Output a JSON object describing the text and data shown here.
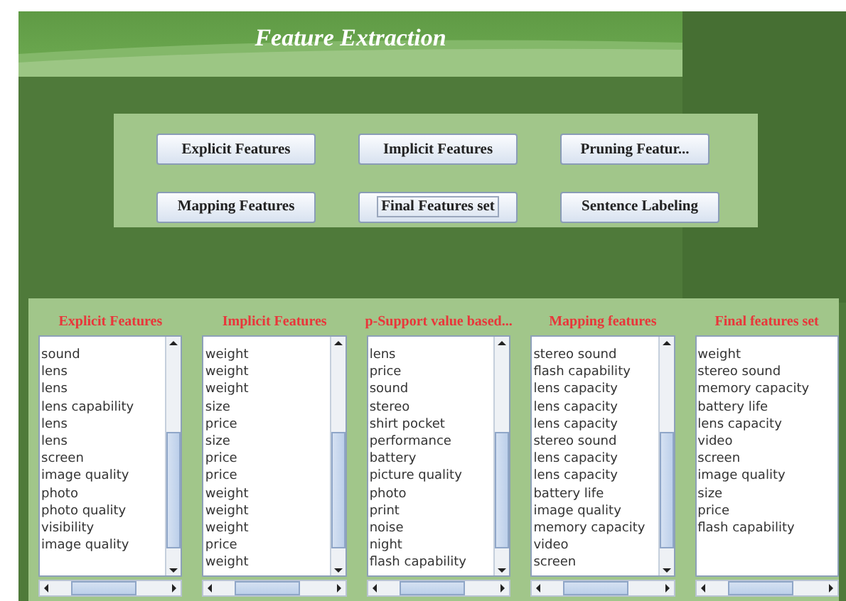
{
  "window": {
    "title": "Feature Extraction"
  },
  "buttons": [
    {
      "label": "Explicit  Features",
      "focused": false
    },
    {
      "label": "Implicit Features",
      "focused": false
    },
    {
      "label": "Pruning Featur...",
      "focused": false
    },
    {
      "label": "Mapping Features",
      "focused": false
    },
    {
      "label": "Final Features set",
      "focused": true
    },
    {
      "label": "Sentence Labeling",
      "focused": false
    }
  ],
  "lists": [
    {
      "title": "Explicit Features",
      "vertical_scrollbar": true,
      "items": [
        "sound",
        "lens",
        "lens",
        "lens capability",
        "lens",
        "lens",
        "screen",
        "image quality",
        "photo",
        "photo quality",
        "visibility",
        "image quality"
      ]
    },
    {
      "title": "Implicit Features",
      "vertical_scrollbar": true,
      "items": [
        "weight",
        "weight",
        "weight",
        "size",
        "price",
        "size",
        "price",
        "price",
        "weight",
        "weight",
        "weight",
        "price",
        "weight"
      ]
    },
    {
      "title": "p-Support value based...",
      "vertical_scrollbar": true,
      "items": [
        "lens",
        "price",
        "sound",
        "stereo",
        "shirt pocket",
        "performance",
        "battery",
        "picture quality",
        "photo",
        "print",
        "noise",
        "night",
        "flash capability"
      ]
    },
    {
      "title": "Mapping features",
      "vertical_scrollbar": true,
      "items": [
        "stereo sound",
        "flash capability",
        "lens capacity",
        "lens capacity",
        "lens capacity",
        "stereo sound",
        "lens capacity",
        "lens capacity",
        "battery life",
        "image quality",
        "memory capacity",
        "video",
        "screen"
      ]
    },
    {
      "title": "Final features set",
      "vertical_scrollbar": false,
      "items": [
        "weight",
        "stereo sound",
        "memory capacity",
        "battery life",
        "lens capacity",
        "video",
        "screen",
        "image quality",
        "size",
        "price",
        "flash capability"
      ]
    }
  ]
}
